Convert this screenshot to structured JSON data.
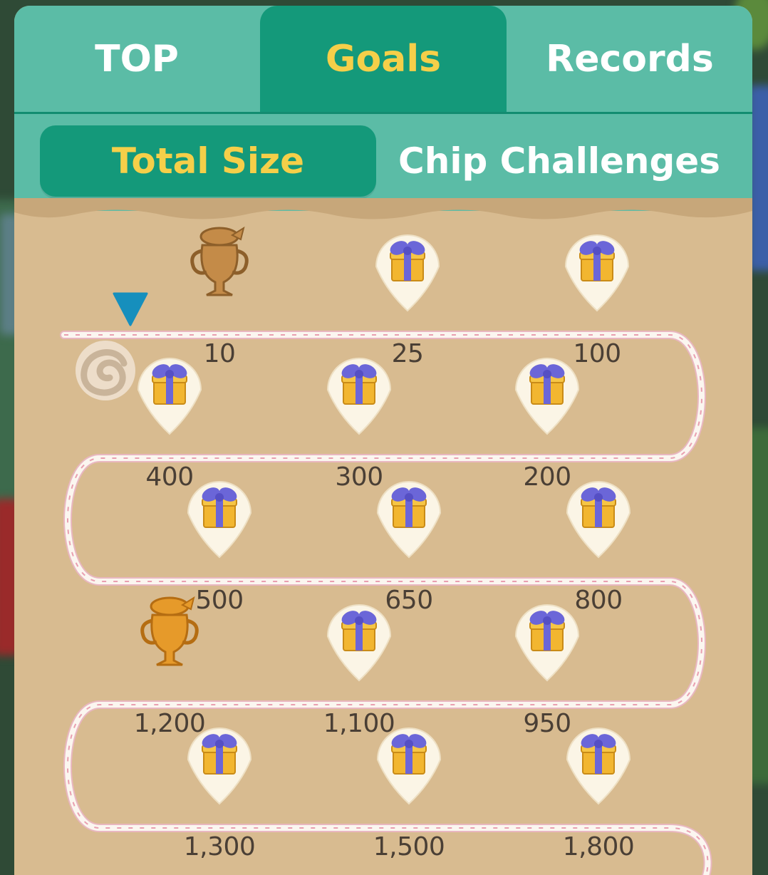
{
  "tabs": [
    {
      "label": "TOP",
      "active": false
    },
    {
      "label": "Goals",
      "active": true
    },
    {
      "label": "Records",
      "active": false
    }
  ],
  "subtabs": [
    {
      "label": "Total Size",
      "active": true
    },
    {
      "label": "Chip Challenges",
      "active": false
    }
  ],
  "goals": [
    {
      "value": "10",
      "reward": "trophy-bronze"
    },
    {
      "value": "25",
      "reward": "gift"
    },
    {
      "value": "100",
      "reward": "gift"
    },
    {
      "value": "200",
      "reward": "gift"
    },
    {
      "value": "300",
      "reward": "gift"
    },
    {
      "value": "400",
      "reward": "gift"
    },
    {
      "value": "500",
      "reward": "gift"
    },
    {
      "value": "650",
      "reward": "gift"
    },
    {
      "value": "800",
      "reward": "gift"
    },
    {
      "value": "950",
      "reward": "gift"
    },
    {
      "value": "1,100",
      "reward": "gift"
    },
    {
      "value": "1,200",
      "reward": "trophy-gold"
    },
    {
      "value": "1,300",
      "reward": "gift"
    },
    {
      "value": "1,500",
      "reward": "gift"
    },
    {
      "value": "1,800",
      "reward": "gift"
    }
  ],
  "colors": {
    "tab_bg": "#5bbca6",
    "tab_active": "#14997a",
    "active_text": "#f5cf49",
    "sand": "#d8bb90",
    "gift_box": "#f2b630",
    "gift_ribbon": "#6b66d8"
  },
  "icons": {
    "current_position": "triangle-down-icon",
    "start": "swirl-icon"
  }
}
